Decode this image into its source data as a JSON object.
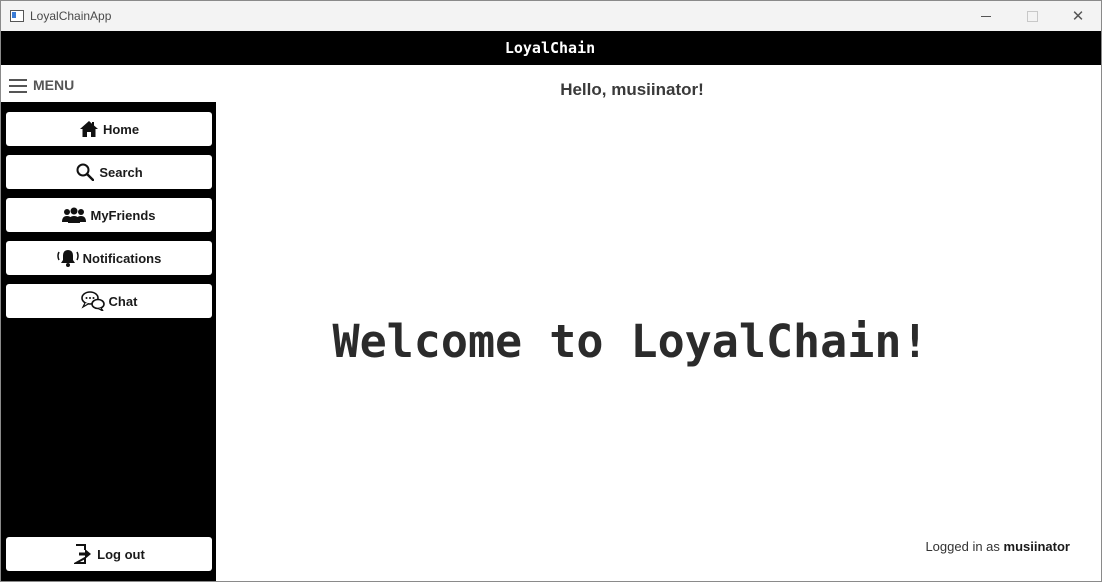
{
  "window": {
    "title": "LoyalChainApp",
    "controls": {
      "close_glyph": "✕"
    }
  },
  "header": {
    "title": "LoyalChain"
  },
  "menu": {
    "label": "MENU",
    "icon": "hamburger-icon"
  },
  "sidebar": {
    "items": [
      {
        "label": "Home",
        "icon": "home-icon"
      },
      {
        "label": "Search",
        "icon": "search-icon"
      },
      {
        "label": "MyFriends",
        "icon": "friends-icon"
      },
      {
        "label": "Notifications",
        "icon": "bell-icon"
      },
      {
        "label": "Chat",
        "icon": "chat-icon"
      }
    ],
    "logout": {
      "label": "Log out",
      "icon": "logout-icon"
    }
  },
  "main": {
    "greeting": "Hello, musiinator!",
    "welcome": "Welcome to LoyalChain!",
    "status_prefix": "Logged in as",
    "status_user": "musiinator"
  },
  "colors": {
    "header_bg": "#000000",
    "sidebar_bg": "#000000",
    "button_bg": "#ffffff",
    "titlebar_bg": "#f3f3f3"
  }
}
